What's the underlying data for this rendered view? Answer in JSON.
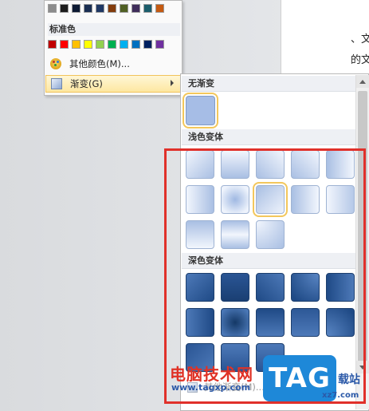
{
  "document": {
    "text_line_1": "、文",
    "text_line_2": "的文"
  },
  "color_menu": {
    "top_swatches": [
      "#8c8c8c",
      "#1c1c1c",
      "#0d1a33",
      "#1a2f52",
      "#1f3864",
      "#833c0c",
      "#506024",
      "#3f2d5a",
      "#1b5d6b",
      "#c55a11"
    ],
    "standard_heading": "标准色",
    "standard_swatches": [
      "#c00000",
      "#ff0000",
      "#ffc000",
      "#ffff00",
      "#92d050",
      "#00b050",
      "#00b0f0",
      "#0070c0",
      "#002060",
      "#7030a0"
    ],
    "more_colors_label": "其他颜色(M)...",
    "gradient_label": "渐变(G)"
  },
  "gradient_menu": {
    "no_gradient_heading": "无渐变",
    "light_heading": "浅色变体",
    "dark_heading": "深色变体",
    "more_gradients_label": "其他渐变(M)...",
    "light_variants": [
      "light-linear-diagonal-down",
      "light-linear-down",
      "light-linear-diagonal-up",
      "light-linear-diagonal-left",
      "light-linear-left",
      "light-linear-right",
      "light-from-center",
      "light-from-corner-selected",
      "light-linear-right-alt",
      "light-linear-left-alt",
      "light-linear-up",
      "light-linear-center",
      "light-linear-corner"
    ],
    "selected_light_variant": 7,
    "dark_variants": [
      "dark-linear-diagonal-down",
      "dark-linear-down",
      "dark-linear-diagonal-up",
      "dark-from-corner",
      "dark-linear-left",
      "dark-linear-right",
      "dark-from-center",
      "dark-linear-up",
      "dark-linear-center",
      "dark-linear-corner",
      "dark-linear-diagonal-down-alt",
      "dark-linear-down-alt",
      "dark-linear-up-alt"
    ],
    "accent_color": "#f3c75c",
    "annotation_color": "#e0302a"
  },
  "watermark": {
    "site_name": "电脑技术网",
    "site_url": "www.tagxp.com",
    "badge": "TAG",
    "tail": "载站",
    "tail_url": "xz7.com"
  }
}
